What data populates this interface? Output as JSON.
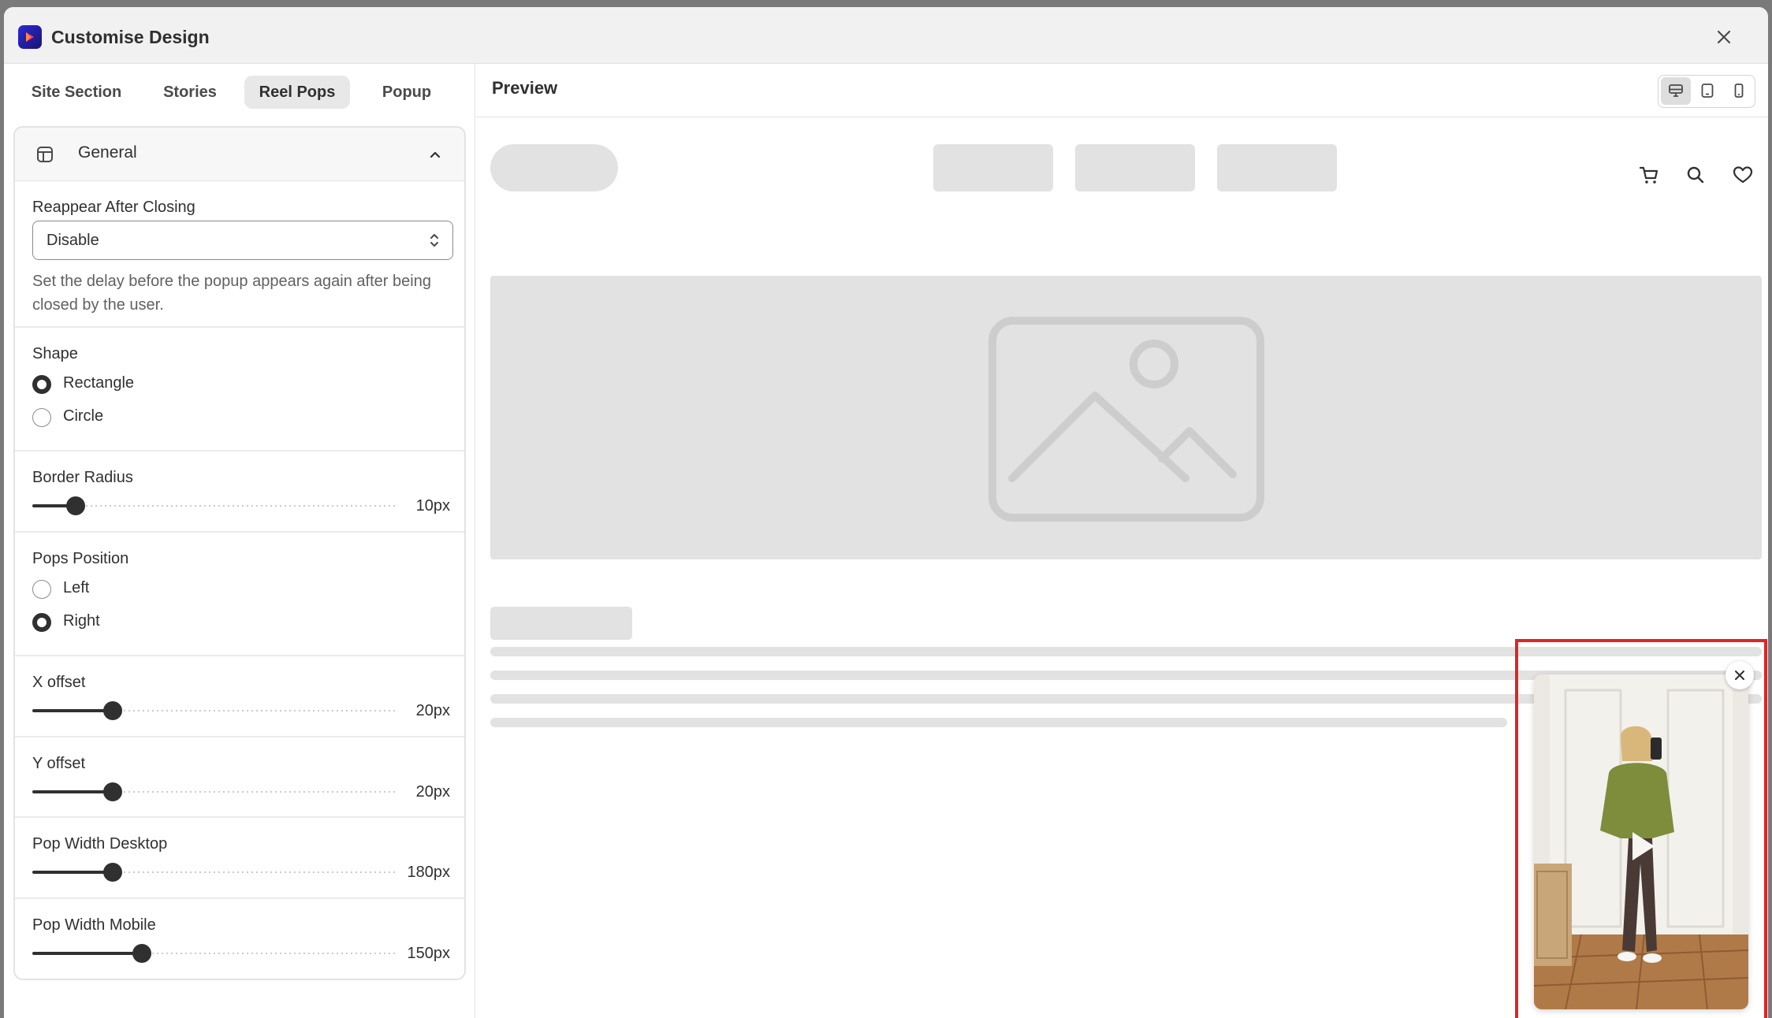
{
  "window": {
    "title": "Customise Design"
  },
  "tabs": [
    {
      "label": "Site Section"
    },
    {
      "label": "Stories"
    },
    {
      "label": "Reel Pops"
    },
    {
      "label": "Popup"
    }
  ],
  "general": {
    "header": "General",
    "reappear": {
      "label": "Reappear After Closing",
      "value": "Disable",
      "help": "Set the delay before the popup appears again after being closed by the user."
    },
    "shape": {
      "label": "Shape",
      "options": [
        {
          "label": "Rectangle",
          "selected": true
        },
        {
          "label": "Circle",
          "selected": false
        }
      ]
    },
    "border_radius": {
      "label": "Border Radius",
      "value": "10px",
      "level": 0.12
    },
    "pops_position": {
      "label": "Pops Position",
      "options": [
        {
          "label": "Left",
          "selected": false
        },
        {
          "label": "Right",
          "selected": true
        }
      ]
    },
    "x_offset": {
      "label": "X offset",
      "value": "20px",
      "level": 0.22
    },
    "y_offset": {
      "label": "Y offset",
      "value": "20px",
      "level": 0.22
    },
    "pop_width_desktop": {
      "label": "Pop Width Desktop",
      "value": "180px",
      "level": 0.22
    },
    "pop_width_mobile": {
      "label": "Pop Width Mobile",
      "value": "150px",
      "level": 0.3
    }
  },
  "preview": {
    "title": "Preview",
    "devices": [
      "desktop-icon",
      "tablet-icon",
      "mobile-icon"
    ],
    "active_device": "desktop",
    "nav_icons": [
      "cart-icon",
      "search-icon",
      "heart-icon"
    ]
  },
  "colors": {
    "highlight": "#e02424",
    "accent": "#303030",
    "placeholder": "#e2e2e2"
  }
}
